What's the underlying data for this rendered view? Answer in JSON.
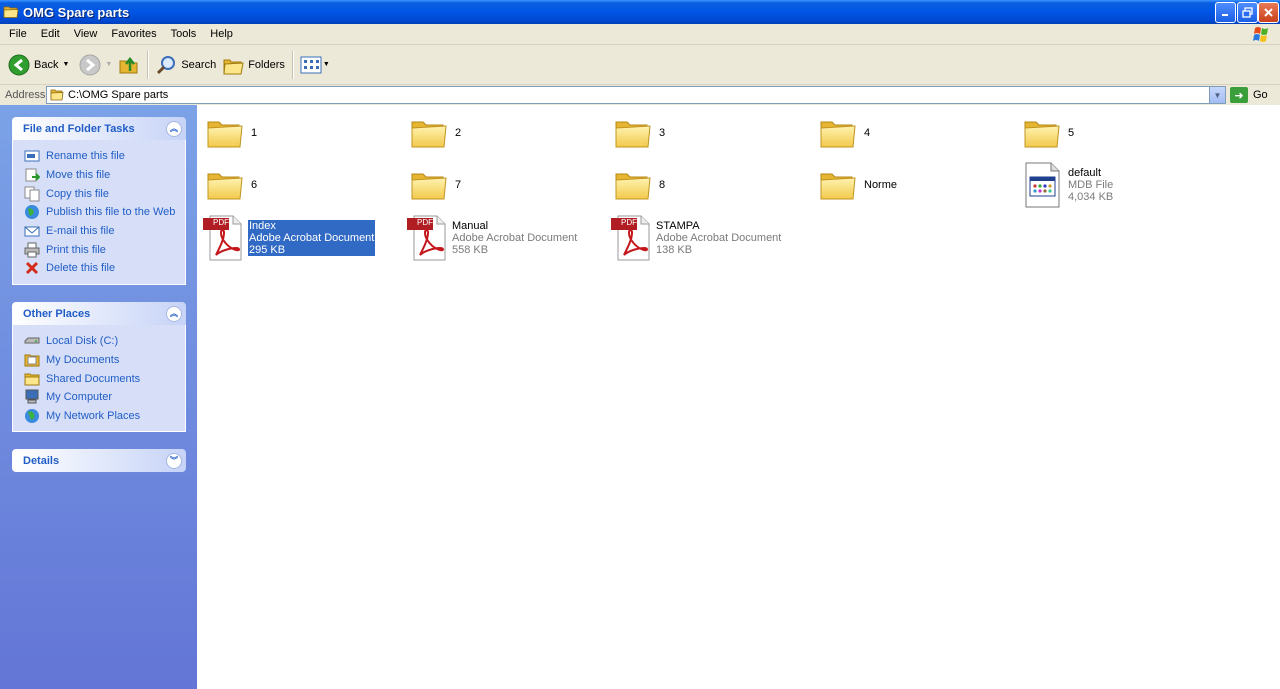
{
  "window": {
    "title": "OMG Spare parts"
  },
  "menu": [
    "File",
    "Edit",
    "View",
    "Favorites",
    "Tools",
    "Help"
  ],
  "toolbar": {
    "back": "Back",
    "search": "Search",
    "folders": "Folders"
  },
  "address": {
    "label": "Address",
    "path": "C:\\OMG Spare parts",
    "go": "Go"
  },
  "tasks": {
    "title": "File and Folder Tasks",
    "items": [
      "Rename this file",
      "Move this file",
      "Copy this file",
      "Publish this file to the Web",
      "E-mail this file",
      "Print this file",
      "Delete this file"
    ]
  },
  "places": {
    "title": "Other Places",
    "items": [
      "Local Disk (C:)",
      "My Documents",
      "Shared Documents",
      "My Computer",
      "My Network Places"
    ]
  },
  "details": {
    "title": "Details"
  },
  "folders": [
    "1",
    "2",
    "3",
    "4",
    "5",
    "6",
    "7",
    "8",
    "Norme"
  ],
  "files": [
    {
      "name": "default",
      "type": "MDB File",
      "size": "4,034 KB"
    },
    {
      "name": "Index",
      "type": "Adobe Acrobat Document",
      "size": "295 KB"
    },
    {
      "name": "Manual",
      "type": "Adobe Acrobat Document",
      "size": "558 KB"
    },
    {
      "name": "STAMPA",
      "type": "Adobe Acrobat Document",
      "size": "138 KB"
    }
  ],
  "pdf_badge": "PDF"
}
